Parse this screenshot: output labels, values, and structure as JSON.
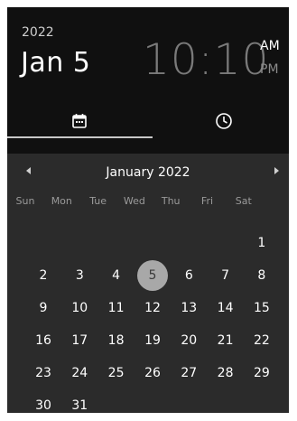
{
  "header": {
    "year": "2022",
    "date": "Jan 5",
    "time": "10:10",
    "am": "AM",
    "pm": "PM"
  },
  "tabs": [
    {
      "name": "date",
      "icon": "calendar-icon",
      "selected": true
    },
    {
      "name": "time",
      "icon": "clock-icon",
      "selected": false
    }
  ],
  "calendar": {
    "month_label": "January 2022",
    "weekdays": [
      "Sun",
      "Mon",
      "Tue",
      "Wed",
      "Thu",
      "Fri",
      "Sat"
    ],
    "selected_day": 5,
    "first_weekday_index": 6,
    "days_in_month": 31
  },
  "colors": {
    "background": "#2b2b2b",
    "header": "#101010",
    "selected_day": "#a8a8a8"
  }
}
